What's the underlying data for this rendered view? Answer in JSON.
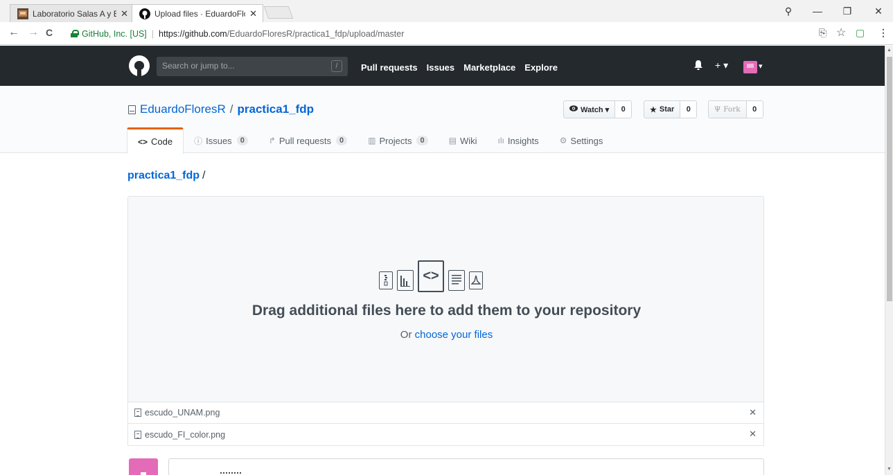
{
  "browser": {
    "tabs": [
      {
        "title": "Laboratorio Salas A y B",
        "active": false
      },
      {
        "title": "Upload files · EduardoFlo",
        "active": true
      }
    ],
    "close_glyph": "✕",
    "window_controls": {
      "profile": "⚲",
      "minimize": "—",
      "restore": "❐",
      "close": "✕"
    },
    "nav": {
      "back": "←",
      "forward": "→",
      "reload": "C"
    },
    "address": {
      "security_label": "GitHub, Inc. [US]",
      "url_host": "https://github.com",
      "url_path": "/EduardoFloresR/practica1_fdp/upload/master"
    },
    "addr_icons": {
      "translate": "⎘",
      "star": "☆",
      "ext": "▢",
      "menu": "⋮"
    }
  },
  "github_header": {
    "search_placeholder": "Search or jump to...",
    "search_key": "/",
    "nav": [
      "Pull requests",
      "Issues",
      "Marketplace",
      "Explore"
    ],
    "bell": "♠",
    "plus": "+ ▾",
    "avatar_caret": "▾"
  },
  "repo": {
    "owner": "EduardoFloresR",
    "name": "practica1_fdp",
    "watch": {
      "label": "Watch ▾",
      "count": "0",
      "icon": "👁"
    },
    "star": {
      "label": "Star",
      "count": "0",
      "icon": "★"
    },
    "fork": {
      "label": "Fork",
      "count": "0",
      "icon": "Ψ"
    },
    "tabs": [
      {
        "label": "Code",
        "icon": "<>",
        "count": null,
        "selected": true
      },
      {
        "label": "Issues",
        "icon": "ⓘ",
        "count": "0",
        "selected": false
      },
      {
        "label": "Pull requests",
        "icon": "↱",
        "count": "0",
        "selected": false
      },
      {
        "label": "Projects",
        "icon": "▥",
        "count": "0",
        "selected": false
      },
      {
        "label": "Wiki",
        "icon": "▤",
        "count": null,
        "selected": false
      },
      {
        "label": "Insights",
        "icon": "ılı",
        "count": null,
        "selected": false
      },
      {
        "label": "Settings",
        "icon": "⚙",
        "count": null,
        "selected": false
      }
    ]
  },
  "breadcrumb": {
    "repo": "practica1_fdp",
    "sep": "/"
  },
  "dropzone": {
    "title": "Drag additional files here to add them to your repository",
    "sub_prefix": "Or",
    "sub_link": "choose your files"
  },
  "files": [
    {
      "name": "escudo_UNAM.png",
      "remove": "✕"
    },
    {
      "name": "escudo_FI_color.png",
      "remove": "✕"
    }
  ],
  "colors": {
    "header_bg": "#24292e",
    "link": "#0366d6",
    "tab_accent": "#e36209",
    "avatar": "#e36bb8"
  }
}
